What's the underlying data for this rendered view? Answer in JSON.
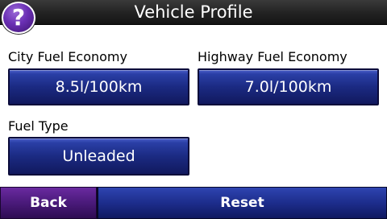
{
  "header": {
    "title": "Vehicle Profile",
    "help_glyph": "?"
  },
  "fields": {
    "city_fuel_economy": {
      "label": "City Fuel Economy",
      "value": "8.5l/100km"
    },
    "highway_fuel_economy": {
      "label": "Highway Fuel Economy",
      "value": "7.0l/100km"
    },
    "fuel_type": {
      "label": "Fuel Type",
      "value": "Unleaded"
    }
  },
  "footer": {
    "back_label": "Back",
    "reset_label": "Reset"
  },
  "colors": {
    "header_bg": "#242424",
    "value_button_bg": "#1b2a82",
    "back_button_bg": "#4a1a7a",
    "reset_button_bg": "#1d2d8c",
    "help_button_bg": "#6a2fb4"
  },
  "icons": {
    "help": "question-mark-icon"
  }
}
